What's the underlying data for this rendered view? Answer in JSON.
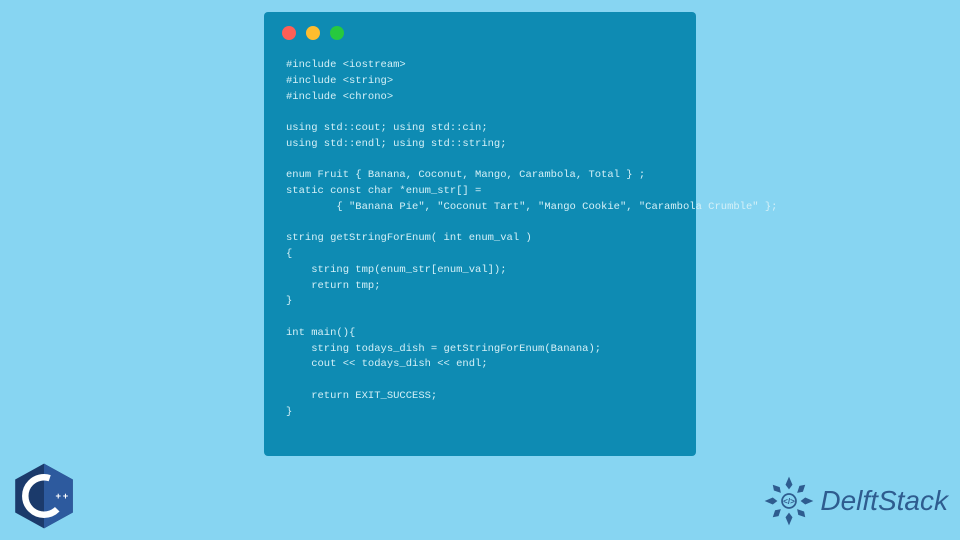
{
  "code": {
    "line1": "#include <iostream>",
    "line2": "#include <string>",
    "line3": "#include <chrono>",
    "blank1": "",
    "line4": "using std::cout; using std::cin;",
    "line5": "using std::endl; using std::string;",
    "blank2": "",
    "line6": "enum Fruit { Banana, Coconut, Mango, Carambola, Total } ;",
    "line7": "static const char *enum_str[] =",
    "line8": "        { \"Banana Pie\", \"Coconut Tart\", \"Mango Cookie\", \"Carambola Crumble\" };",
    "blank3": "",
    "line9": "string getStringForEnum( int enum_val )",
    "line10": "{",
    "line11": "    string tmp(enum_str[enum_val]);",
    "line12": "    return tmp;",
    "line13": "}",
    "blank4": "",
    "line14": "int main(){",
    "line15": "    string todays_dish = getStringForEnum(Banana);",
    "line16": "    cout << todays_dish << endl;",
    "blank5": "",
    "line17": "    return EXIT_SUCCESS;",
    "line18": "}"
  },
  "cpp_label": "C++",
  "brand": "DelftStack"
}
